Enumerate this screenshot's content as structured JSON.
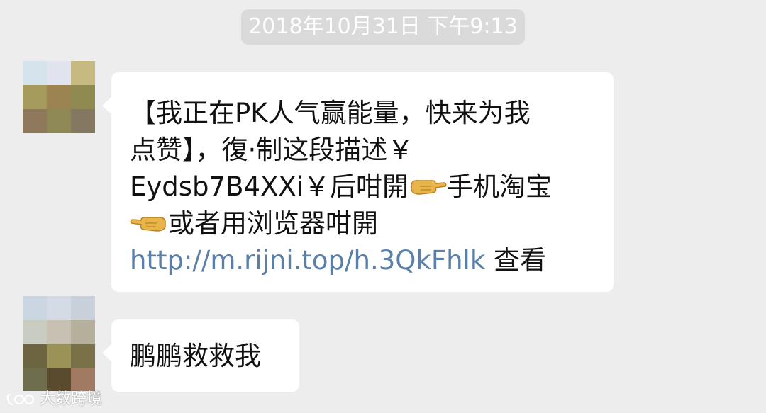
{
  "timestamp": "2018年10月31日 下午9:13",
  "messages": [
    {
      "type": "received",
      "lines": {
        "l1": "【我正在PK人气赢能量，快来为我",
        "l2": "点赞】，復·制这段描述￥",
        "l3a": "Eydsb7B4XXi￥后咁開",
        "l3b": "手机淘宝",
        "l4": "或者用浏览器咁開",
        "link": "http://m.rijni.top/h.3QkFhlk",
        "view": " 查看"
      },
      "emoji": [
        "pointing-right-hand",
        "pointing-left-hand"
      ]
    },
    {
      "type": "received",
      "text": "鹏鹏救救我"
    }
  ],
  "avatars": {
    "first": [
      "#d5e3ec",
      "#e1e4ef",
      "#c7ba80",
      "#a49a5b",
      "#9b8451",
      "#8f8a4f",
      "#8e785c",
      "#8d8854",
      "#847860"
    ],
    "second": [
      "#cad6e1",
      "#d4dbe5",
      "#c8d0da",
      "#c9ccc1",
      "#c8c1b3",
      "#b4b09c",
      "#6d6441",
      "#9b9257",
      "#7a7148",
      "#6e6e4f"
    ]
  },
  "watermark": "大数跨境"
}
